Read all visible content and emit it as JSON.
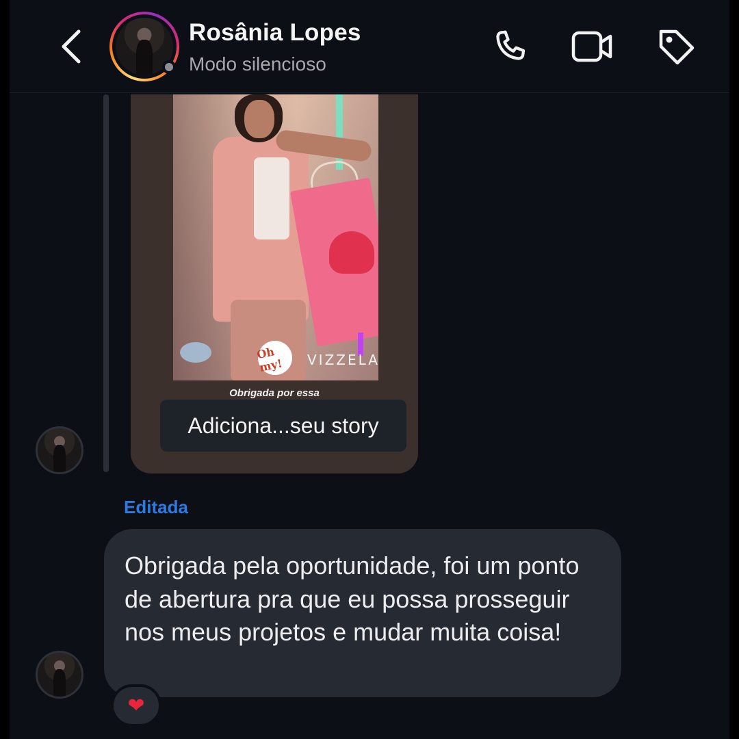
{
  "header": {
    "contact_name": "Rosânia Lopes",
    "status": "Modo silencioso",
    "icons": [
      "back-chevron-icon",
      "phone-icon",
      "video-camera-icon",
      "tag-icon"
    ]
  },
  "story_reply": {
    "caption": "Obrigada por essa",
    "sticker_text": "Adiciona...seu story",
    "photo_logo_oh": "Oh my!",
    "photo_logo_brand": "VIZZELA"
  },
  "message": {
    "edited_label": "Editada",
    "text": "Obrigada pela oportunidade, foi um ponto de abertura pra que eu possa prosseguir nos meus projetos e mudar muita coisa!",
    "reaction": "❤"
  },
  "colors": {
    "background": "#0c0f16",
    "bubble": "#262a33",
    "edited_accent": "#2c7be5",
    "reaction_heart": "#e8253b"
  }
}
